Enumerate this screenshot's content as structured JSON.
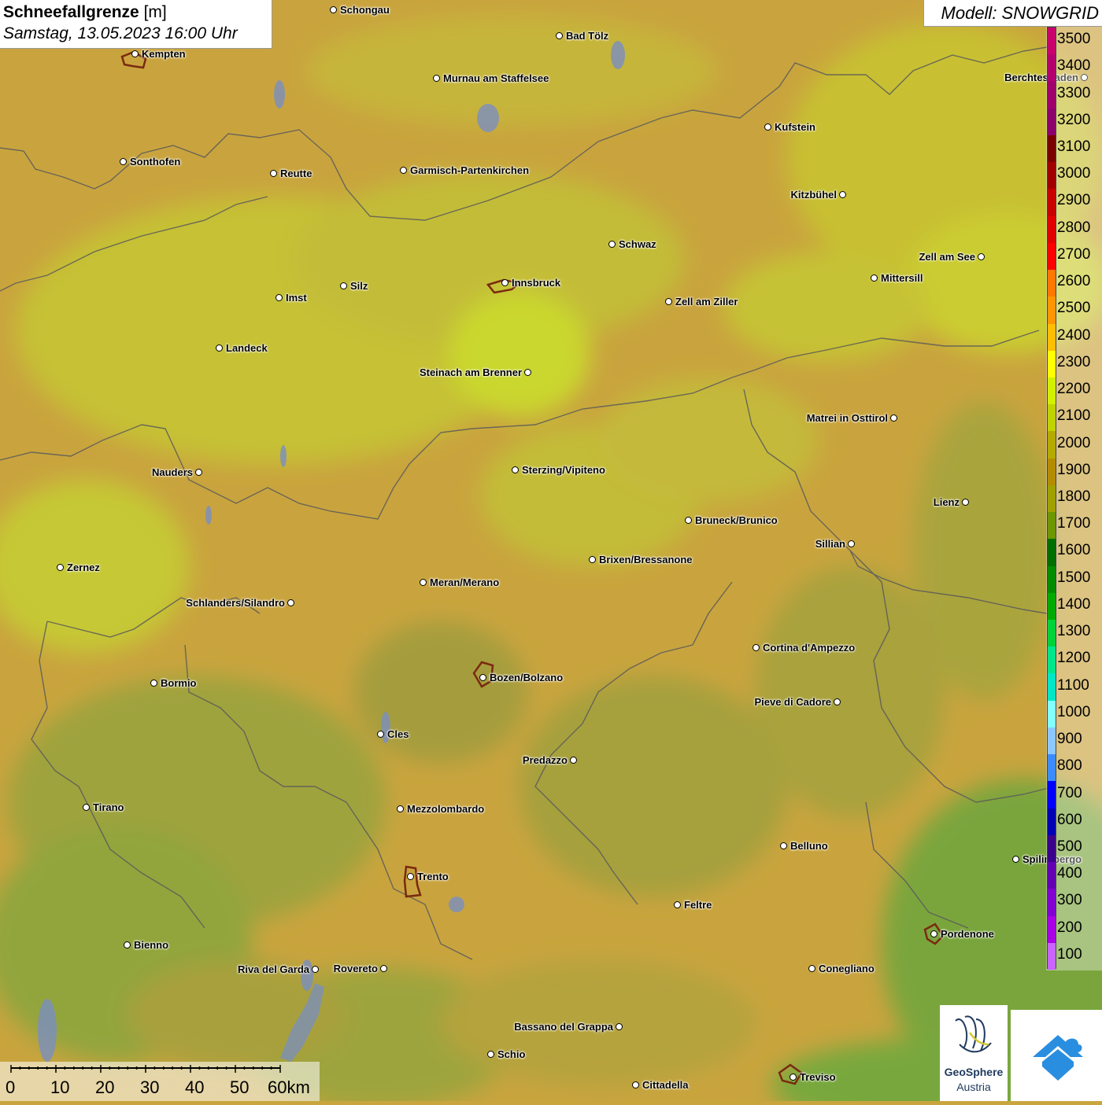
{
  "title": {
    "name": "Schneefallgrenze",
    "unit": "[m]",
    "datetime": "Samstag, 13.05.2023 16:00 Uhr"
  },
  "model": "Modell: SNOWGRID",
  "legend": {
    "labels": [
      "3500",
      "3400",
      "3300",
      "3200",
      "3100",
      "3000",
      "2900",
      "2800",
      "2700",
      "2600",
      "2500",
      "2400",
      "2300",
      "2200",
      "2100",
      "2000",
      "1900",
      "1800",
      "1700",
      "1600",
      "1500",
      "1400",
      "1300",
      "1200",
      "1100",
      "1000",
      "900",
      "800",
      "700",
      "600",
      "500",
      "400",
      "300",
      "200",
      "100"
    ],
    "colors": [
      "#c8006e",
      "#b4006e",
      "#a0006e",
      "#8c006e",
      "#780000",
      "#a00000",
      "#c80000",
      "#e00000",
      "#ff0000",
      "#ff7800",
      "#ff9600",
      "#ffbe00",
      "#ffff00",
      "#d2f000",
      "#c0d200",
      "#b4aa00",
      "#b48c00",
      "#a0a000",
      "#6e9600",
      "#006e00",
      "#008c00",
      "#00aa00",
      "#00d23c",
      "#00e68c",
      "#00e6c8",
      "#82ffff",
      "#8cc8ff",
      "#3c8cff",
      "#0000ff",
      "#0000b4",
      "#3c008c",
      "#6400b4",
      "#8200d2",
      "#aa00e6",
      "#c864ff"
    ]
  },
  "scale": {
    "labels": [
      "0",
      "10",
      "20",
      "30",
      "40",
      "50",
      "60km"
    ]
  },
  "logo": {
    "line1": "GeoSphere",
    "line2": "Austria"
  },
  "cities": [
    {
      "name": "Schongau"
    },
    {
      "name": "Bad Tölz"
    },
    {
      "name": "Kempten"
    },
    {
      "name": "Murnau am Staffelsee"
    },
    {
      "name": "Berchtesgaden"
    },
    {
      "name": "Kufstein"
    },
    {
      "name": "Sonthofen"
    },
    {
      "name": "Reutte"
    },
    {
      "name": "Garmisch-Partenkirchen"
    },
    {
      "name": "Kitzbühel"
    },
    {
      "name": "Schwaz"
    },
    {
      "name": "Zell am See"
    },
    {
      "name": "Mittersill"
    },
    {
      "name": "Innsbruck"
    },
    {
      "name": "Imst"
    },
    {
      "name": "Silz"
    },
    {
      "name": "Zell am Ziller"
    },
    {
      "name": "Landeck"
    },
    {
      "name": "Steinach am Brenner"
    },
    {
      "name": "Matrei in Osttirol"
    },
    {
      "name": "Nauders"
    },
    {
      "name": "Sterzing/Vipiteno"
    },
    {
      "name": "Lienz"
    },
    {
      "name": "Bruneck/Brunico"
    },
    {
      "name": "Sillian"
    },
    {
      "name": "Brixen/Bressanone"
    },
    {
      "name": "Zernez"
    },
    {
      "name": "Meran/Merano"
    },
    {
      "name": "Schlanders/Silandro"
    },
    {
      "name": "Cortina d'Ampezzo"
    },
    {
      "name": "Bozen/Bolzano"
    },
    {
      "name": "Bormio"
    },
    {
      "name": "Pieve di Cadore"
    },
    {
      "name": "Cles"
    },
    {
      "name": "Predazzo"
    },
    {
      "name": "Tirano"
    },
    {
      "name": "Mezzolombardo"
    },
    {
      "name": "Belluno"
    },
    {
      "name": "Spilimbergo"
    },
    {
      "name": "Trento"
    },
    {
      "name": "Feltre"
    },
    {
      "name": "Pordenone"
    },
    {
      "name": "Bienno"
    },
    {
      "name": "Riva del Garda"
    },
    {
      "name": "Rovereto"
    },
    {
      "name": "Conegliano"
    },
    {
      "name": "Bassano del Grappa"
    },
    {
      "name": "Schio"
    },
    {
      "name": "Treviso"
    },
    {
      "name": "Cittadella"
    }
  ]
}
